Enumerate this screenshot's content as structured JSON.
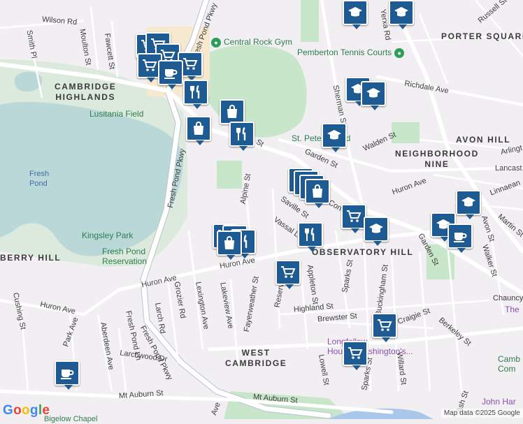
{
  "map": {
    "brand": "Google",
    "attribution": "Map data ©2025 Google",
    "colors": {
      "background": "#f2eff3",
      "water": "#a9c7e8",
      "park": "#c8e6c9",
      "road": "#ffffff",
      "marker": "#1f5b93"
    },
    "areas": {
      "porter_square": "PORTER SQUARE",
      "cambridge_highlands": "CAMBRIDGE\nHIGHLANDS",
      "avon_hill": "AVON HILL",
      "neighborhood_nine": "NEIGHBORHOOD\nNINE",
      "observatory_hill": "OBSERVATORY HILL",
      "west_cambridge": "WEST\nCAMBRIDGE",
      "berry_hill": "BERRY HILL"
    },
    "pois": {
      "central_rock_gym": "Central Rock Gym",
      "pemberton": "Pemberton Tennis Courts",
      "lusitania": "Lusitania Field",
      "kingsley": "Kingsley Park",
      "fresh_pond_res": "Fresh Pond\nReservation",
      "fresh_pond": "Fresh\nPond",
      "st_peters": "St. Peter's Field",
      "longfellow": "Longfellow\nHouse–Washington's...",
      "john_har": "John Har",
      "the_partial": "The",
      "camb_partial": "Camb\nCom",
      "bigelow": "Bigelow Chapel"
    },
    "streets": {
      "wilson": "Wilson Rd",
      "smith": "Smith Pl",
      "moulton": "Moulton St",
      "fawcett": "Fawcett St",
      "pkwy_top": "Fresh Pond Pkwy",
      "fresh_pond_pkwy": "Fresh Pond Pkwy",
      "fresh_pond_pkwy2": "Fresh Pond Pkwy",
      "alpine": "Alpine St",
      "garden": "Garden St",
      "garden2": "Garden St",
      "walden": "Walden St",
      "huron_ave": "Huron Ave",
      "huron_ave_w": "Huron Ave",
      "huron_ave_sw": "Huron Ave",
      "huron_ave_e": "Huron Ave",
      "concord": "Concord Ave",
      "saville": "Saville St",
      "vassal": "Vassal Ln",
      "sherman": "Sherman St",
      "richdale": "Richdale Ave",
      "russell": "Russell St",
      "yerxa": "Yerxa Rd",
      "lakeview": "Lakeview Ave",
      "lexington": "Lexington Ave",
      "grozier": "Grozier Rd",
      "larch": "Larch Rd",
      "fresh_pond_ln": "Fresh Pond Ln",
      "larchwood": "Larchwood Dr",
      "fayerweather": "Fayerweather St",
      "reservoir": "Reservoir St",
      "appleton": "Appleton St",
      "highland": "Highland St",
      "brewster": "Brewster St",
      "sparks": "Sparks St",
      "sparks2": "Sparks St",
      "buckingham": "Buckingham St",
      "lowell": "Lowell St",
      "willard": "Willard St",
      "ash": "Ash St",
      "craigie": "Craigie St",
      "berkeley": "Berkeley St",
      "chauncy": "Chauncy",
      "walker": "Walker St",
      "avon": "Avon St",
      "martin": "Martin St",
      "linnaean": "Linnaean",
      "lancaster": "Lancast",
      "arlington": "Arlingt",
      "cushing": "Cushing St",
      "park": "Park Ave",
      "aberdeen": "Aberdeen Ave",
      "mt_auburn": "Mt Auburn St",
      "mt_auburn2": "Mt Auburn St",
      "lakeview_s": "Ave",
      "st_partial": "St"
    },
    "markers": [
      {
        "icon": "cart-icon",
        "label": "Shopping"
      },
      {
        "icon": "coffee-icon",
        "label": "Cafe"
      },
      {
        "icon": "utensils-icon",
        "label": "Restaurant"
      },
      {
        "icon": "bag-icon",
        "label": "Store"
      },
      {
        "icon": "school-icon",
        "label": "School"
      }
    ]
  }
}
